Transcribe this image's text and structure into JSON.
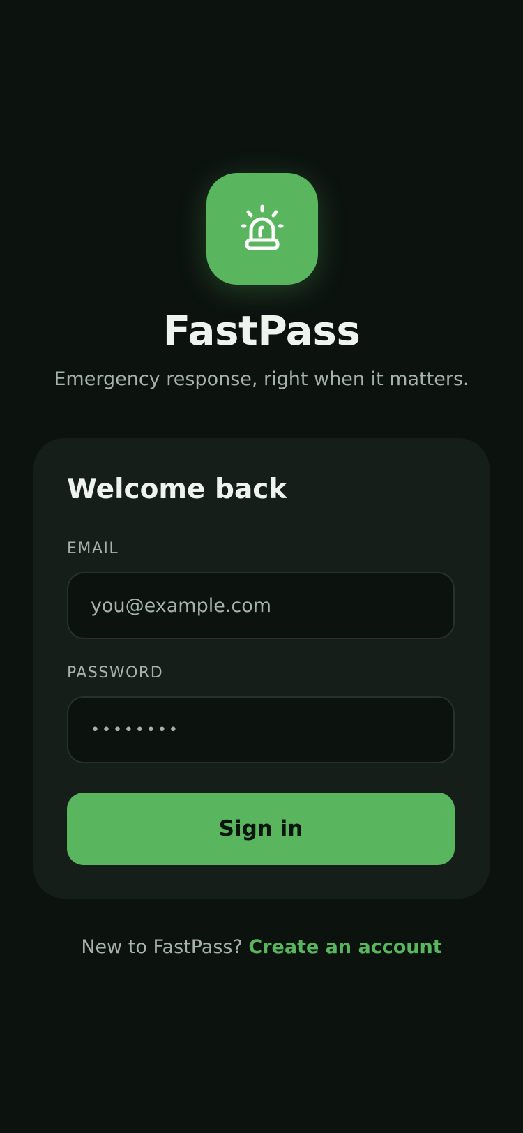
{
  "app": {
    "title": "FastPass",
    "tagline": "Emergency response, right when it matters.",
    "logo_icon": "siren-icon",
    "accent_color": "#59b65e"
  },
  "login_card": {
    "heading": "Welcome back",
    "email": {
      "label": "EMAIL",
      "placeholder": "you@example.com",
      "value": ""
    },
    "password": {
      "label": "PASSWORD",
      "value": "••••••••"
    },
    "submit_label": "Sign in"
  },
  "footer": {
    "prompt": "New to FastPass?",
    "link_label": "Create an account"
  }
}
